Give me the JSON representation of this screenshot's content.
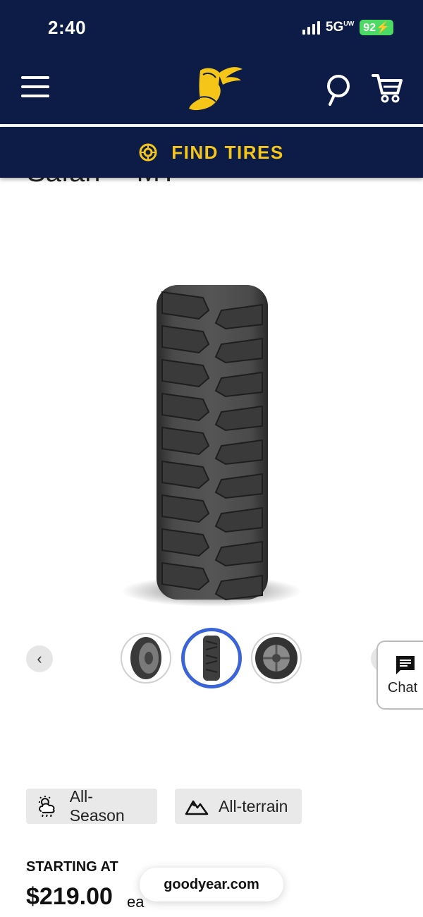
{
  "status_bar": {
    "time": "2:40",
    "network": "5G",
    "network_sup": "UW",
    "battery": "92"
  },
  "header": {
    "menu_icon": "hamburger-menu-icon",
    "logo_icon": "winged-foot-logo",
    "search_icon": "search-icon",
    "cart_icon": "cart-icon",
    "bg_color": "#0c1c47"
  },
  "find_tires": {
    "label": "FIND TIRES",
    "icon": "tire-icon",
    "color": "#f5c518"
  },
  "product": {
    "title": "Safari™ MT",
    "image_icon": "tire-tread-image"
  },
  "carousel": {
    "prev_label": "‹",
    "thumbnails": [
      "tire-angle-view",
      "tire-tread-view",
      "tire-sidewall-view"
    ],
    "selected_index": 1,
    "selected_color": "#3a64d8"
  },
  "chat": {
    "label": "Chat",
    "icon": "chat-bubble-icon"
  },
  "tags": [
    {
      "label": "All-Season",
      "icon": "weather-icon"
    },
    {
      "label": "All-terrain",
      "icon": "mountain-icon"
    }
  ],
  "pricing": {
    "starting_label": "STARTING AT",
    "price": "$219.00",
    "unit": "ea"
  },
  "url_pill": {
    "label": "goodyear.com"
  }
}
